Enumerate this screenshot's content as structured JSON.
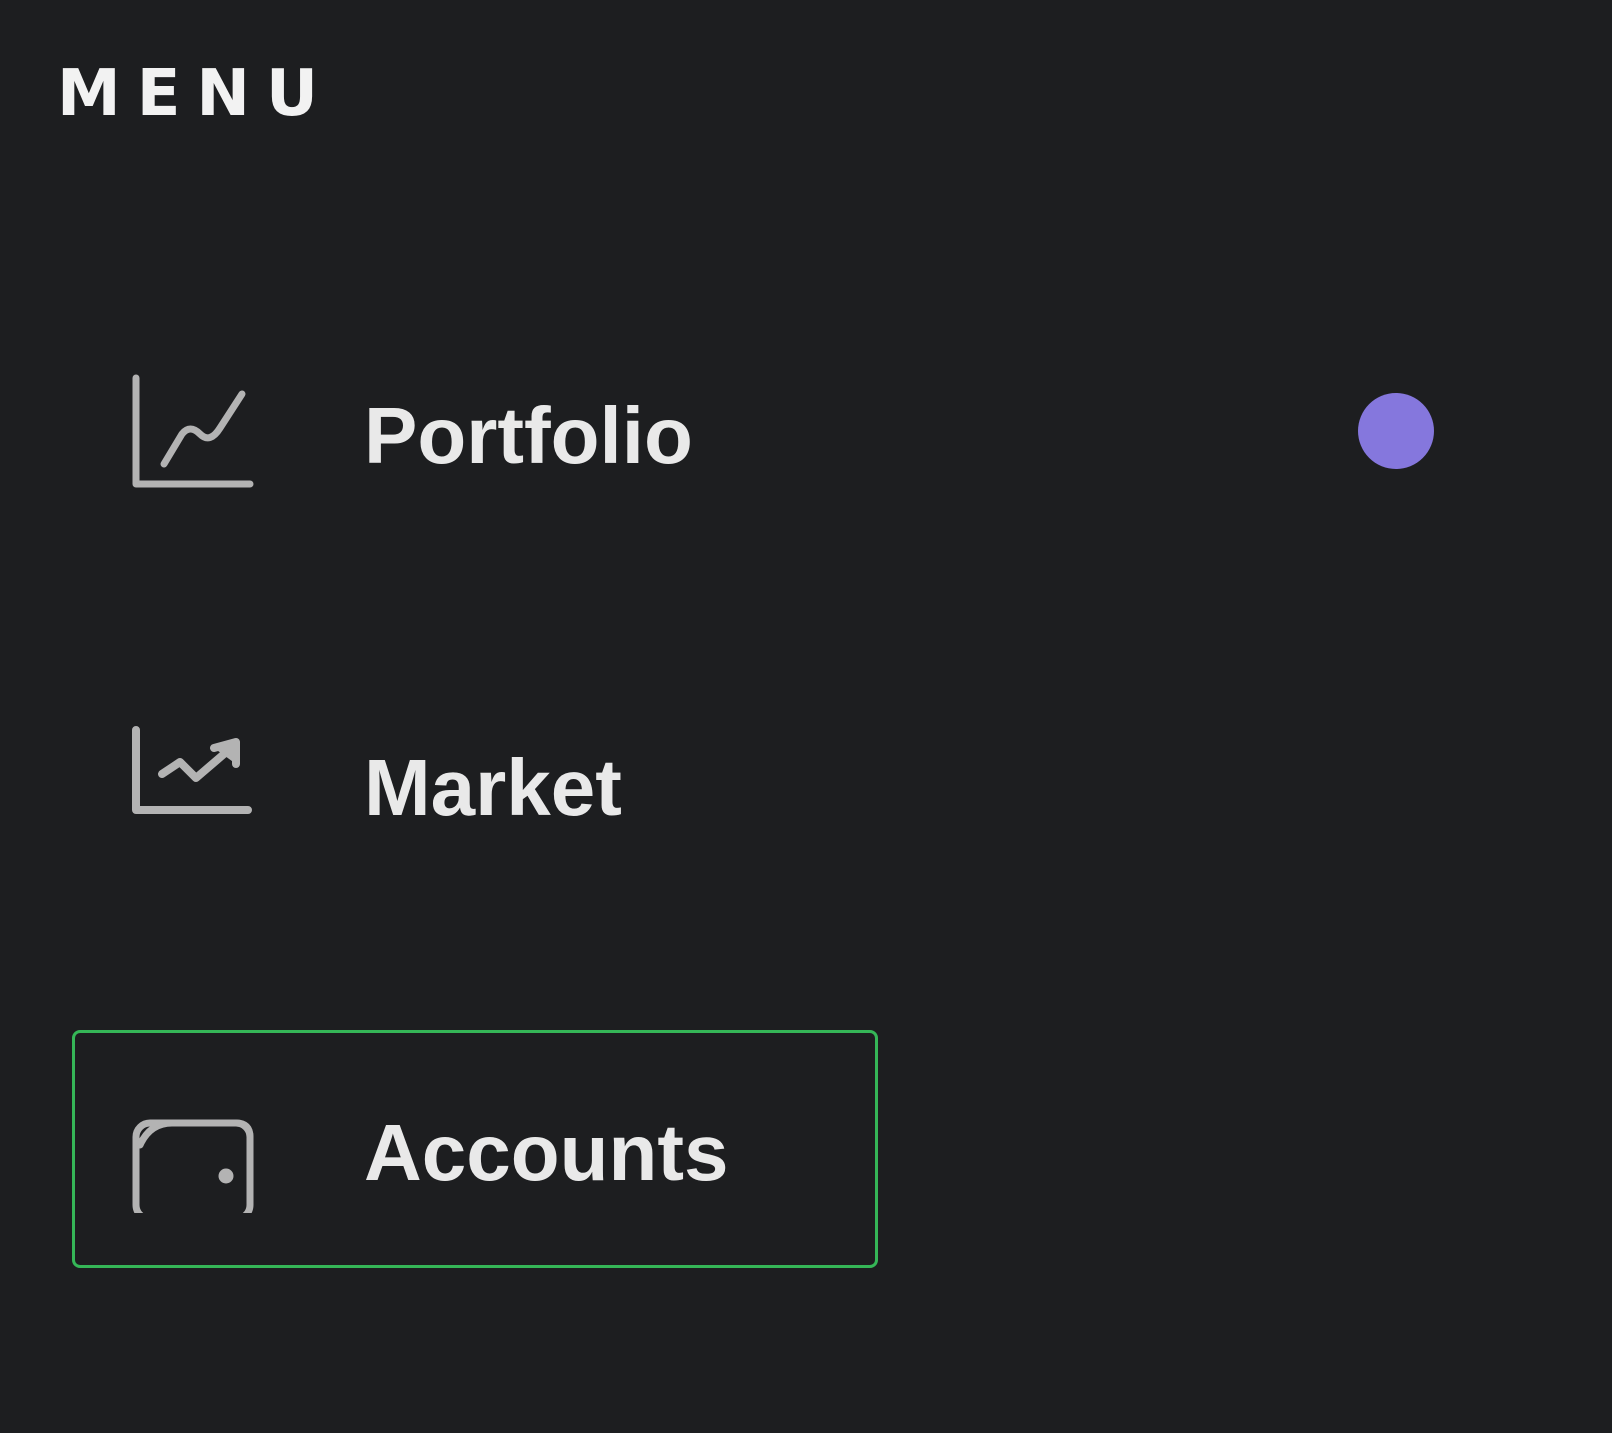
{
  "menu": {
    "heading": "MENU",
    "items": [
      {
        "label": "Portfolio",
        "icon": "line-chart-icon",
        "selected": false,
        "has_notification": true
      },
      {
        "label": "Market",
        "icon": "trending-up-chart-icon",
        "selected": false,
        "has_notification": false
      },
      {
        "label": "Accounts",
        "icon": "wallet-icon",
        "selected": true,
        "has_notification": false
      }
    ]
  },
  "colors": {
    "background": "#1d1e20",
    "text": "#e9e9e9",
    "icon": "#b3b3b3",
    "selection_border": "#35b657",
    "notification_dot": "#8577dd"
  }
}
